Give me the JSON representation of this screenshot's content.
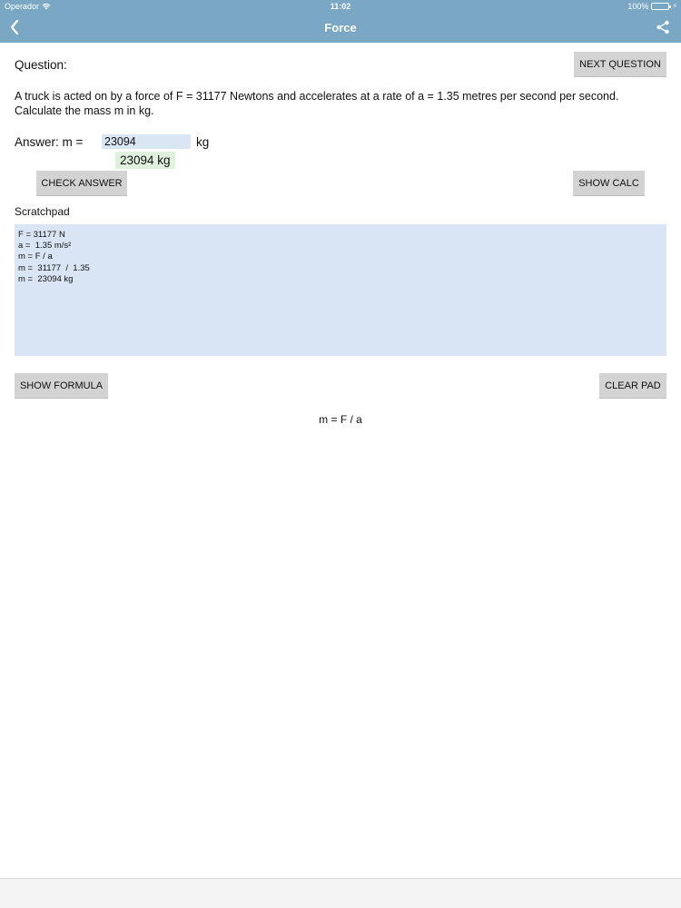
{
  "status": {
    "carrier": "Operador",
    "time": "11:02",
    "battery": "100%"
  },
  "nav": {
    "title": "Force"
  },
  "question": {
    "label": "Question:",
    "text": "A truck is acted on by a force of F = 31177 Newtons  and  accelerates at a rate of a = 1.35 metres per second per second. Calculate the  mass m in kg.",
    "next_button": "NEXT QUESTION"
  },
  "answer": {
    "label": "Answer:  m =",
    "value": "23094",
    "unit": "kg",
    "result": "23094 kg",
    "check_button": "CHECK ANSWER",
    "show_calc_button": "SHOW CALC"
  },
  "scratchpad": {
    "label": "Scratchpad",
    "lines": [
      "F = 31177 N",
      "a =  1.35 m/s²",
      "m = F / a",
      "m =  31177  /  1.35",
      "m =  23094 kg"
    ]
  },
  "formula": {
    "show_button": "SHOW FORMULA",
    "clear_button": "CLEAR PAD",
    "text": "m = F / a"
  },
  "colors": {
    "navbar": "#7aa7c4",
    "scratchpad": "#d9e4f5",
    "result": "#e0f2de",
    "button": "#d3d3d3"
  }
}
